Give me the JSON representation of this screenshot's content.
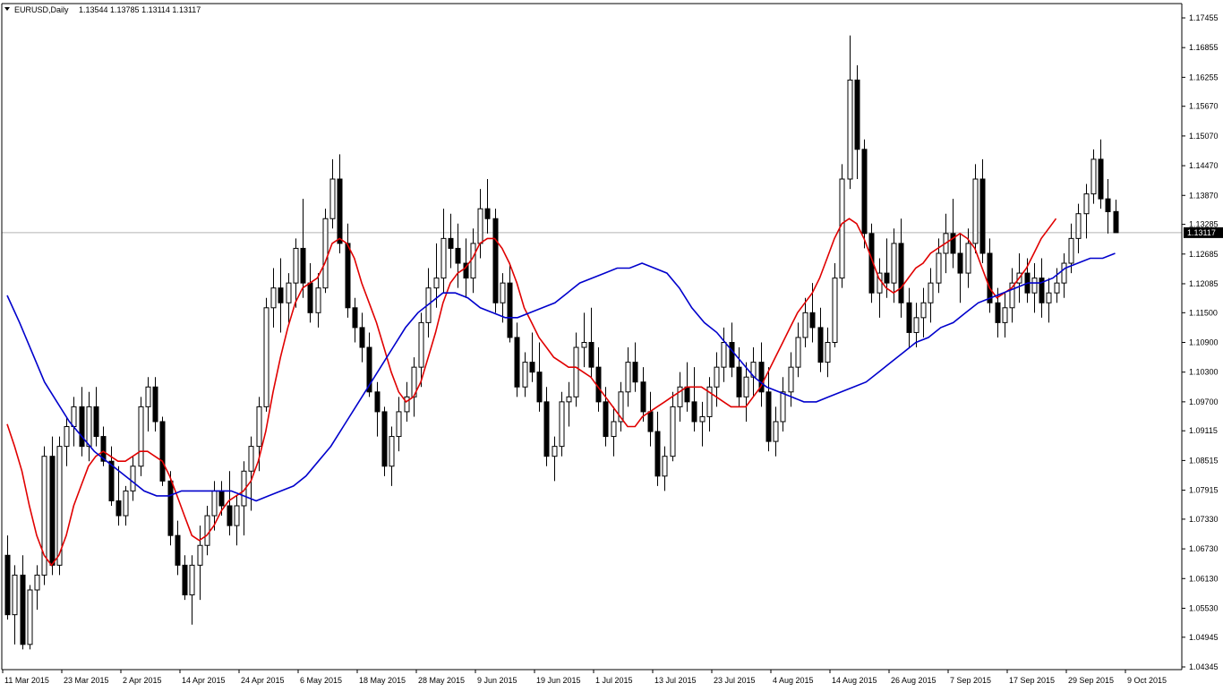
{
  "header": {
    "symbol": "EURUSD,Daily",
    "ohlc": "1.13544 1.13785 1.13114 1.13117"
  },
  "colors": {
    "fast_ma": "#e00000",
    "slow_ma": "#0000cc",
    "candle": "#000000",
    "background": "#ffffff"
  },
  "chart_data": {
    "type": "candlestick",
    "title": "",
    "xlabel": "",
    "ylabel": "",
    "ylim": [
      1.04325,
      1.1775
    ],
    "grid": false,
    "current_price": 1.13117,
    "current_price_label": "1.13117",
    "y_ticks": [
      "1.17455",
      "1.16855",
      "1.16255",
      "1.15670",
      "1.15070",
      "1.14470",
      "1.13870",
      "1.13285",
      "1.12685",
      "1.12085",
      "1.11500",
      "1.10900",
      "1.10300",
      "1.09700",
      "1.09115",
      "1.08515",
      "1.07915",
      "1.07330",
      "1.06730",
      "1.06130",
      "1.05530",
      "1.04945",
      "1.04345"
    ],
    "x_labels": [
      {
        "i": 0,
        "label": "11 Mar 2015"
      },
      {
        "i": 8,
        "label": "23 Mar 2015"
      },
      {
        "i": 16,
        "label": "2 Apr 2015"
      },
      {
        "i": 24,
        "label": "14 Apr 2015"
      },
      {
        "i": 32,
        "label": "24 Apr 2015"
      },
      {
        "i": 40,
        "label": "6 May 2015"
      },
      {
        "i": 48,
        "label": "18 May 2015"
      },
      {
        "i": 56,
        "label": "28 May 2015"
      },
      {
        "i": 64,
        "label": "9 Jun 2015"
      },
      {
        "i": 72,
        "label": "19 Jun 2015"
      },
      {
        "i": 80,
        "label": "1 Jul 2015"
      },
      {
        "i": 88,
        "label": "13 Jul 2015"
      },
      {
        "i": 96,
        "label": "23 Jul 2015"
      },
      {
        "i": 104,
        "label": "4 Aug 2015"
      },
      {
        "i": 112,
        "label": "14 Aug 2015"
      },
      {
        "i": 120,
        "label": "26 Aug 2015"
      },
      {
        "i": 128,
        "label": "7 Sep 2015"
      },
      {
        "i": 136,
        "label": "17 Sep 2015"
      },
      {
        "i": 144,
        "label": "29 Sep 2015"
      },
      {
        "i": 152,
        "label": "9 Oct 2015"
      }
    ],
    "candles": [
      [
        1.066,
        1.07,
        1.053,
        1.054
      ],
      [
        1.054,
        1.064,
        1.048,
        1.062
      ],
      [
        1.062,
        1.066,
        1.047,
        1.048
      ],
      [
        1.048,
        1.06,
        1.047,
        1.059
      ],
      [
        1.059,
        1.064,
        1.055,
        1.062
      ],
      [
        1.062,
        1.088,
        1.06,
        1.086
      ],
      [
        1.086,
        1.09,
        1.062,
        1.064
      ],
      [
        1.064,
        1.09,
        1.062,
        1.088
      ],
      [
        1.088,
        1.094,
        1.084,
        1.092
      ],
      [
        1.092,
        1.098,
        1.088,
        1.096
      ],
      [
        1.096,
        1.1,
        1.086,
        1.088
      ],
      [
        1.088,
        1.099,
        1.085,
        1.096
      ],
      [
        1.096,
        1.1,
        1.088,
        1.09
      ],
      [
        1.09,
        1.092,
        1.084,
        1.085
      ],
      [
        1.085,
        1.088,
        1.076,
        1.077
      ],
      [
        1.077,
        1.084,
        1.072,
        1.074
      ],
      [
        1.074,
        1.08,
        1.072,
        1.079
      ],
      [
        1.079,
        1.086,
        1.077,
        1.084
      ],
      [
        1.084,
        1.098,
        1.082,
        1.096
      ],
      [
        1.096,
        1.102,
        1.091,
        1.1
      ],
      [
        1.1,
        1.102,
        1.091,
        1.093
      ],
      [
        1.093,
        1.094,
        1.08,
        1.081
      ],
      [
        1.081,
        1.083,
        1.068,
        1.07
      ],
      [
        1.07,
        1.073,
        1.062,
        1.064
      ],
      [
        1.064,
        1.066,
        1.057,
        1.058
      ],
      [
        1.058,
        1.066,
        1.052,
        1.064
      ],
      [
        1.064,
        1.072,
        1.057,
        1.068
      ],
      [
        1.068,
        1.076,
        1.066,
        1.074
      ],
      [
        1.074,
        1.081,
        1.071,
        1.079
      ],
      [
        1.079,
        1.081,
        1.074,
        1.076
      ],
      [
        1.076,
        1.083,
        1.07,
        1.072
      ],
      [
        1.072,
        1.078,
        1.068,
        1.076
      ],
      [
        1.076,
        1.085,
        1.07,
        1.083
      ],
      [
        1.083,
        1.09,
        1.075,
        1.088
      ],
      [
        1.088,
        1.098,
        1.083,
        1.096
      ],
      [
        1.096,
        1.118,
        1.095,
        1.116
      ],
      [
        1.116,
        1.124,
        1.112,
        1.12
      ],
      [
        1.12,
        1.126,
        1.111,
        1.117
      ],
      [
        1.117,
        1.123,
        1.113,
        1.121
      ],
      [
        1.121,
        1.13,
        1.116,
        1.128
      ],
      [
        1.128,
        1.138,
        1.118,
        1.121
      ],
      [
        1.121,
        1.125,
        1.113,
        1.115
      ],
      [
        1.115,
        1.123,
        1.112,
        1.12
      ],
      [
        1.12,
        1.136,
        1.119,
        1.134
      ],
      [
        1.134,
        1.146,
        1.132,
        1.142
      ],
      [
        1.142,
        1.147,
        1.127,
        1.129
      ],
      [
        1.129,
        1.133,
        1.114,
        1.116
      ],
      [
        1.116,
        1.118,
        1.109,
        1.112
      ],
      [
        1.112,
        1.115,
        1.105,
        1.108
      ],
      [
        1.108,
        1.111,
        1.098,
        1.099
      ],
      [
        1.099,
        1.101,
        1.09,
        1.095
      ],
      [
        1.095,
        1.096,
        1.082,
        1.084
      ],
      [
        1.084,
        1.092,
        1.08,
        1.09
      ],
      [
        1.09,
        1.098,
        1.087,
        1.095
      ],
      [
        1.095,
        1.101,
        1.093,
        1.098
      ],
      [
        1.098,
        1.106,
        1.094,
        1.104
      ],
      [
        1.104,
        1.115,
        1.1,
        1.113
      ],
      [
        1.113,
        1.124,
        1.11,
        1.12
      ],
      [
        1.12,
        1.129,
        1.116,
        1.122
      ],
      [
        1.122,
        1.136,
        1.119,
        1.13
      ],
      [
        1.13,
        1.135,
        1.124,
        1.128
      ],
      [
        1.128,
        1.133,
        1.12,
        1.125
      ],
      [
        1.125,
        1.13,
        1.118,
        1.122
      ],
      [
        1.122,
        1.132,
        1.119,
        1.129
      ],
      [
        1.129,
        1.14,
        1.126,
        1.136
      ],
      [
        1.136,
        1.142,
        1.131,
        1.134
      ],
      [
        1.134,
        1.136,
        1.115,
        1.117
      ],
      [
        1.117,
        1.123,
        1.113,
        1.121
      ],
      [
        1.121,
        1.125,
        1.109,
        1.11
      ],
      [
        1.11,
        1.113,
        1.098,
        1.1
      ],
      [
        1.1,
        1.107,
        1.098,
        1.105
      ],
      [
        1.105,
        1.111,
        1.101,
        1.103
      ],
      [
        1.103,
        1.109,
        1.095,
        1.097
      ],
      [
        1.097,
        1.1,
        1.084,
        1.086
      ],
      [
        1.086,
        1.09,
        1.081,
        1.088
      ],
      [
        1.088,
        1.099,
        1.086,
        1.097
      ],
      [
        1.097,
        1.101,
        1.092,
        1.098
      ],
      [
        1.098,
        1.111,
        1.096,
        1.108
      ],
      [
        1.108,
        1.115,
        1.104,
        1.109
      ],
      [
        1.109,
        1.116,
        1.102,
        1.104
      ],
      [
        1.104,
        1.108,
        1.095,
        1.097
      ],
      [
        1.097,
        1.1,
        1.088,
        1.09
      ],
      [
        1.09,
        1.096,
        1.086,
        1.093
      ],
      [
        1.093,
        1.101,
        1.091,
        1.099
      ],
      [
        1.099,
        1.108,
        1.096,
        1.105
      ],
      [
        1.105,
        1.109,
        1.099,
        1.101
      ],
      [
        1.101,
        1.104,
        1.093,
        1.095
      ],
      [
        1.095,
        1.099,
        1.088,
        1.091
      ],
      [
        1.091,
        1.095,
        1.08,
        1.082
      ],
      [
        1.082,
        1.088,
        1.079,
        1.086
      ],
      [
        1.086,
        1.099,
        1.085,
        1.096
      ],
      [
        1.096,
        1.103,
        1.093,
        1.1
      ],
      [
        1.1,
        1.105,
        1.095,
        1.097
      ],
      [
        1.097,
        1.104,
        1.091,
        1.093
      ],
      [
        1.093,
        1.097,
        1.088,
        1.094
      ],
      [
        1.094,
        1.102,
        1.091,
        1.1
      ],
      [
        1.1,
        1.107,
        1.096,
        1.104
      ],
      [
        1.104,
        1.112,
        1.101,
        1.109
      ],
      [
        1.109,
        1.113,
        1.102,
        1.104
      ],
      [
        1.104,
        1.108,
        1.096,
        1.098
      ],
      [
        1.098,
        1.105,
        1.093,
        1.102
      ],
      [
        1.102,
        1.108,
        1.098,
        1.105
      ],
      [
        1.105,
        1.109,
        1.096,
        1.099
      ],
      [
        1.099,
        1.104,
        1.087,
        1.089
      ],
      [
        1.089,
        1.096,
        1.086,
        1.093
      ],
      [
        1.093,
        1.102,
        1.091,
        1.099
      ],
      [
        1.099,
        1.107,
        1.096,
        1.104
      ],
      [
        1.104,
        1.113,
        1.102,
        1.11
      ],
      [
        1.11,
        1.118,
        1.108,
        1.115
      ],
      [
        1.115,
        1.121,
        1.109,
        1.112
      ],
      [
        1.112,
        1.116,
        1.103,
        1.105
      ],
      [
        1.105,
        1.112,
        1.102,
        1.109
      ],
      [
        1.109,
        1.125,
        1.108,
        1.122
      ],
      [
        1.122,
        1.145,
        1.12,
        1.142
      ],
      [
        1.142,
        1.171,
        1.14,
        1.162
      ],
      [
        1.162,
        1.165,
        1.142,
        1.148
      ],
      [
        1.148,
        1.15,
        1.128,
        1.131
      ],
      [
        1.131,
        1.133,
        1.117,
        1.119
      ],
      [
        1.119,
        1.126,
        1.114,
        1.123
      ],
      [
        1.123,
        1.13,
        1.118,
        1.121
      ],
      [
        1.121,
        1.132,
        1.117,
        1.129
      ],
      [
        1.129,
        1.134,
        1.114,
        1.117
      ],
      [
        1.117,
        1.12,
        1.108,
        1.111
      ],
      [
        1.111,
        1.117,
        1.108,
        1.114
      ],
      [
        1.114,
        1.12,
        1.11,
        1.117
      ],
      [
        1.117,
        1.124,
        1.113,
        1.121
      ],
      [
        1.121,
        1.13,
        1.119,
        1.127
      ],
      [
        1.127,
        1.135,
        1.123,
        1.131
      ],
      [
        1.131,
        1.138,
        1.124,
        1.127
      ],
      [
        1.127,
        1.131,
        1.117,
        1.123
      ],
      [
        1.123,
        1.132,
        1.12,
        1.129
      ],
      [
        1.129,
        1.145,
        1.127,
        1.142
      ],
      [
        1.142,
        1.146,
        1.125,
        1.127
      ],
      [
        1.127,
        1.13,
        1.115,
        1.117
      ],
      [
        1.117,
        1.12,
        1.11,
        1.113
      ],
      [
        1.113,
        1.119,
        1.11,
        1.116
      ],
      [
        1.116,
        1.124,
        1.113,
        1.121
      ],
      [
        1.121,
        1.127,
        1.117,
        1.123
      ],
      [
        1.123,
        1.126,
        1.117,
        1.119
      ],
      [
        1.119,
        1.125,
        1.115,
        1.122
      ],
      [
        1.122,
        1.126,
        1.114,
        1.117
      ],
      [
        1.117,
        1.122,
        1.113,
        1.119
      ],
      [
        1.119,
        1.124,
        1.117,
        1.121
      ],
      [
        1.121,
        1.127,
        1.118,
        1.125
      ],
      [
        1.125,
        1.133,
        1.123,
        1.13
      ],
      [
        1.13,
        1.137,
        1.127,
        1.135
      ],
      [
        1.135,
        1.141,
        1.13,
        1.139
      ],
      [
        1.139,
        1.148,
        1.137,
        1.146
      ],
      [
        1.146,
        1.15,
        1.136,
        1.138
      ],
      [
        1.138,
        1.142,
        1.131,
        1.1354
      ],
      [
        1.13544,
        1.13785,
        1.13114,
        1.13117
      ]
    ],
    "ma_fast": {
      "color": "#e00000",
      "values": [
        1.0925,
        1.088,
        1.083,
        1.076,
        1.07,
        1.066,
        1.064,
        1.066,
        1.07,
        1.076,
        1.08,
        1.084,
        1.086,
        1.087,
        1.086,
        1.085,
        1.085,
        1.086,
        1.087,
        1.087,
        1.086,
        1.085,
        1.082,
        1.078,
        1.074,
        1.07,
        1.069,
        1.07,
        1.072,
        1.075,
        1.077,
        1.078,
        1.079,
        1.081,
        1.085,
        1.091,
        1.099,
        1.106,
        1.112,
        1.117,
        1.12,
        1.121,
        1.122,
        1.125,
        1.129,
        1.13,
        1.129,
        1.126,
        1.121,
        1.117,
        1.113,
        1.108,
        1.103,
        1.099,
        1.097,
        1.098,
        1.101,
        1.106,
        1.111,
        1.117,
        1.121,
        1.123,
        1.124,
        1.126,
        1.129,
        1.13,
        1.13,
        1.128,
        1.125,
        1.121,
        1.116,
        1.113,
        1.11,
        1.108,
        1.106,
        1.105,
        1.104,
        1.104,
        1.103,
        1.102,
        1.1,
        1.098,
        1.096,
        1.094,
        1.092,
        1.092,
        1.094,
        1.095,
        1.096,
        1.097,
        1.098,
        1.099,
        1.1,
        1.1,
        1.1,
        1.099,
        1.098,
        1.097,
        1.096,
        1.096,
        1.096,
        1.098,
        1.1,
        1.103,
        1.106,
        1.109,
        1.112,
        1.115,
        1.117,
        1.119,
        1.122,
        1.126,
        1.13,
        1.133,
        1.134,
        1.133,
        1.13,
        1.126,
        1.122,
        1.12,
        1.119,
        1.12,
        1.122,
        1.124,
        1.125,
        1.127,
        1.128,
        1.129,
        1.13,
        1.131,
        1.13,
        1.128,
        1.124,
        1.12,
        1.118,
        1.119,
        1.12,
        1.122,
        1.124,
        1.127,
        1.13,
        1.132,
        1.134
      ]
    },
    "ma_slow": {
      "color": "#0000cc",
      "values": [
        1.1185,
        1.113,
        1.107,
        1.101,
        1.097,
        1.093,
        1.09,
        1.087,
        1.085,
        1.083,
        1.081,
        1.079,
        1.078,
        1.078,
        1.079,
        1.079,
        1.079,
        1.079,
        1.079,
        1.078,
        1.077,
        1.078,
        1.079,
        1.08,
        1.082,
        1.085,
        1.088,
        1.092,
        1.096,
        1.1,
        1.104,
        1.108,
        1.112,
        1.115,
        1.117,
        1.119,
        1.119,
        1.118,
        1.116,
        1.115,
        1.114,
        1.114,
        1.115,
        1.116,
        1.117,
        1.119,
        1.121,
        1.122,
        1.123,
        1.124,
        1.124,
        1.125,
        1.124,
        1.123,
        1.12,
        1.116,
        1.113,
        1.111,
        1.108,
        1.105,
        1.102,
        1.1,
        1.099,
        1.098,
        1.097,
        1.097,
        1.098,
        1.099,
        1.1,
        1.101,
        1.103,
        1.105,
        1.107,
        1.109,
        1.11,
        1.112,
        1.113,
        1.115,
        1.117,
        1.118,
        1.119,
        1.12,
        1.121,
        1.121,
        1.122,
        1.124,
        1.125,
        1.126,
        1.126,
        1.127
      ]
    }
  }
}
